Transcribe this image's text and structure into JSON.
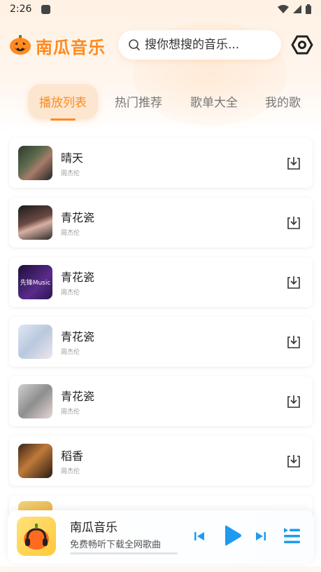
{
  "status_bar": {
    "time": "2:26"
  },
  "header": {
    "app_title": "南瓜音乐",
    "search_placeholder": "搜你想搜的音乐..."
  },
  "tabs": [
    {
      "label": "播放列表",
      "active": true
    },
    {
      "label": "热门推荐",
      "active": false
    },
    {
      "label": "歌单大全",
      "active": false
    },
    {
      "label": "我的歌",
      "active": false
    }
  ],
  "songs": [
    {
      "title": "晴天",
      "artist": "周杰伦"
    },
    {
      "title": "青花瓷",
      "artist": "周杰伦"
    },
    {
      "title": "青花瓷",
      "artist": "周杰伦"
    },
    {
      "title": "青花瓷",
      "artist": "周杰伦"
    },
    {
      "title": "青花瓷",
      "artist": "周杰伦"
    },
    {
      "title": "稻香",
      "artist": "周杰伦"
    }
  ],
  "cover_art_text": {
    "song_3": "先锋Music"
  },
  "player": {
    "title": "南瓜音乐",
    "subtitle": "免费畅听下载全网歌曲"
  },
  "colors": {
    "accent": "#ff8a1f",
    "play_blue": "#1e9bf0",
    "tab_active_bg": "#fde6cf"
  },
  "icons": [
    "pumpkin-logo-icon",
    "search-icon",
    "settings-hexagon-icon",
    "download-icon",
    "previous-icon",
    "play-icon",
    "next-icon",
    "playlist-icon",
    "wifi-icon",
    "signal-icon",
    "battery-icon"
  ]
}
